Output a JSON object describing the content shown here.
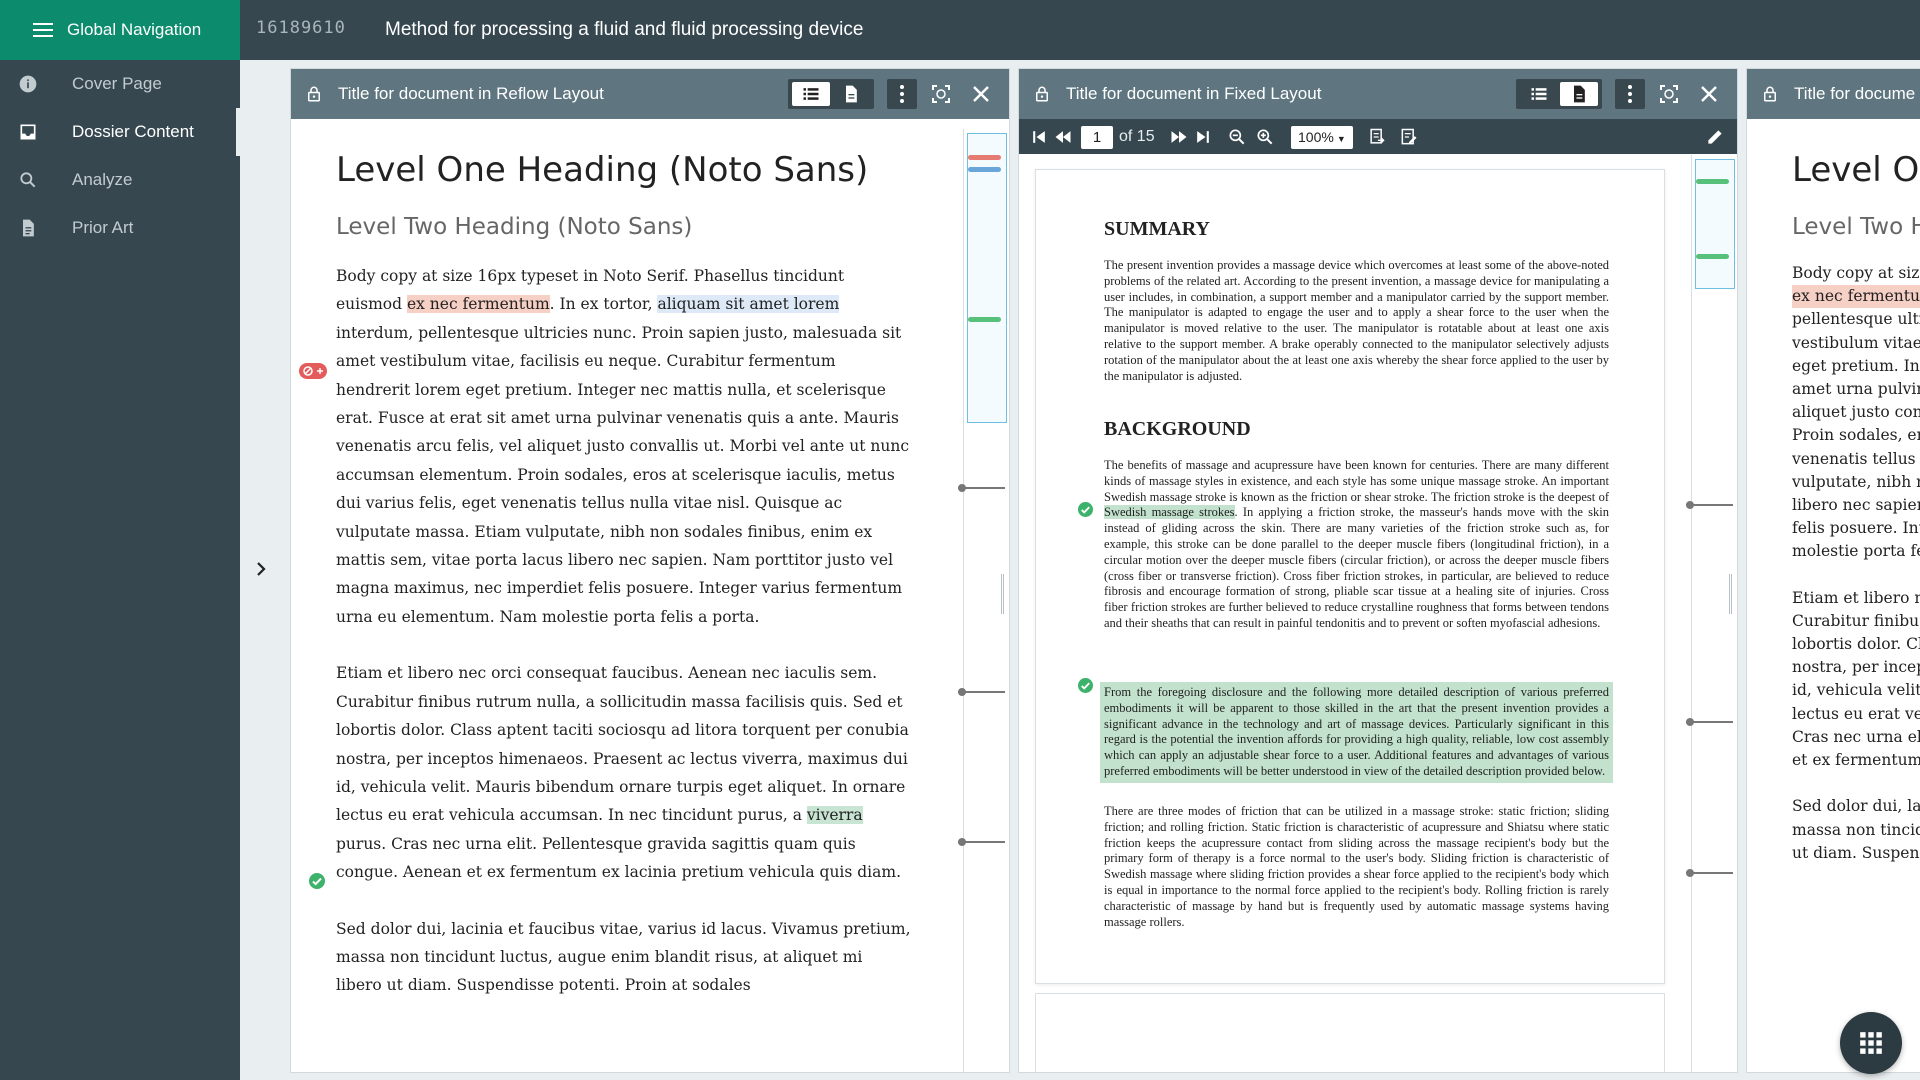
{
  "global_nav": {
    "label": "Global Navigation"
  },
  "document": {
    "id": "16189610",
    "title": "Method for processing a fluid and fluid processing device"
  },
  "sidebar": {
    "items": [
      {
        "label": "Cover Page",
        "icon": "info-icon"
      },
      {
        "label": "Dossier Content",
        "icon": "inbox-icon",
        "active": true
      },
      {
        "label": "Analyze",
        "icon": "search-icon"
      },
      {
        "label": "Prior Art",
        "icon": "document-icon"
      }
    ]
  },
  "panels": {
    "reflow": {
      "title": "Title for document in Reflow Layout",
      "heading1": "Level One Heading  (Noto Sans)",
      "heading2": "Level Two Heading (Noto Sans)",
      "p1_a": "Body copy at size 16px typeset in Noto Serif. Phasellus tincidunt euismod ",
      "p1_hl_red": "ex nec fermentum",
      "p1_b": ". In ex tortor, ",
      "p1_hl_blue": "aliquam sit amet lorem",
      "p1_c": " interdum, pellentesque ultricies nunc. Proin sapien justo, malesuada sit amet vestibulum vitae, facilisis eu neque. Curabitur fermentum hendrerit lorem eget pretium. Integer nec mattis nulla, et scelerisque erat. Fusce at erat sit amet urna pulvinar venenatis quis a ante. Mauris venenatis arcu felis, vel aliquet justo convallis ut. Morbi vel ante ut nunc accumsan elementum. Proin sodales, eros at scelerisque iaculis, metus dui varius felis, eget venenatis tellus nulla vitae nisl. Quisque ac vulputate massa. Etiam vulputate, nibh non sodales finibus, enim ex mattis sem, vitae porta lacus libero nec sapien. Nam porttitor justo vel magna maximus, nec imperdiet felis posuere. Integer varius fermentum urna eu elementum. Nam molestie porta felis a porta.",
      "p2_a": "Etiam et libero nec orci consequat faucibus. Aenean nec iaculis sem. Curabitur finibus rutrum nulla, a sollicitudin massa facilisis quis. Sed et lobortis dolor. Class aptent taciti sociosqu ad litora torquent per conubia nostra, per inceptos himenaeos. Praesent ac lectus viverra, maximus dui id, vehicula velit. Mauris bibendum ornare turpis eget aliquet. In ornare lectus eu erat vehicula accumsan. In nec tincidunt purus, a ",
      "p2_hl_green": "viverra",
      "p2_b": " purus. Cras nec urna elit. Pellentesque gravida sagittis quam quis congue. Aenean et ex fermentum ex lacinia pretium vehicula quis diam.",
      "p3": "Sed dolor dui, lacinia et faucibus vitae, varius id lacus. Vivamus pretium, massa non tincidunt luctus, augue enim blandit risus, at aliquet mi libero ut diam. Suspendisse potenti. Proin at sodales"
    },
    "fixed": {
      "title": "Title for document in Fixed Layout",
      "page_current": "1",
      "page_of": "of 15",
      "zoom": "100%",
      "summary_heading": "SUMMARY",
      "summary_text": "The present invention provides a massage device which overcomes at least some of the above-noted problems of the related art. According to the present invention, a massage device for manipulating a user includes, in combination, a support member and a manipulator carried by the support member. The manipulator is adapted to engage the user and to apply a shear force to the user when the manipulator is moved relative to the user. The manipulator is rotatable about at least one axis relative to the support member. A brake operably connected to the manipulator selectively adjusts rotation of the manipulator about the at least one axis whereby the shear force applied to the user by the manipulator is adjusted.",
      "background_heading": "BACKGROUND",
      "bg1_a": "The benefits of massage and acupressure have been known for centuries. There are many different kinds of massage styles in existence, and each style has some unique massage stroke. An important Swedish massage stroke is known as the friction or shear stroke. The friction stroke is the deepest of ",
      "bg1_hl": "Swedish massage strokes",
      "bg1_b": ". In applying a friction stroke, the masseur's hands move with the skin instead of gliding across the skin. There are many varieties of the friction stroke such as, for example, this stroke can be done parallel to the deeper muscle fibers (longitudinal friction), in a circular motion over the deeper muscle fibers (circular friction), or across the deeper muscle fibers (cross fiber or transverse friction). Cross fiber friction strokes, in particular, are believed to reduce fibrosis and encourage formation of strong, pliable scar tissue at a healing site of injuries. Cross fiber friction strokes are further believed to reduce crystalline roughness that forms between tendons and their sheaths that can result in painful tendonitis and to prevent or soften myofascial adhesions.",
      "bg2": "From the foregoing disclosure and the following more detailed description of various preferred embodiments it will be apparent to those skilled in the art that the present invention provides a significant advance in the technology and art of massage devices. Particularly significant in this regard is the potential the invention affords for providing a high quality, reliable, low cost assembly which can apply an adjustable shear force to a user. Additional features and advantages of various preferred embodiments will be better understood in view of the detailed description provided below.",
      "bg3": "There are three modes of friction that can be utilized in a massage stroke: static friction; sliding friction; and rolling friction. Static friction is characteristic of acupressure and Shiatsu where static friction keeps the acupressure contact from sliding across the massage recipient's body but the primary form of therapy is a force normal to the user's body. Sliding friction is characteristic of Swedish massage where sliding friction provides a shear force applied to the recipient's body which is equal in importance to the normal force applied to the recipient's body. Rolling friction is rarely characteristic of massage by hand but is frequently used by automatic massage systems having massage rollers."
    },
    "third": {
      "title": "Title for docume",
      "heading1": "Level On",
      "heading2": "Level Two H",
      "lines": [
        "Body copy at size",
        "ex nec fermentum",
        "pellentesque ultr",
        "vestibulum vitae",
        "eget pretium. Int",
        "amet urna pulvin",
        "aliquet justo conv",
        "Proin sodales, er",
        "venenatis tellus n",
        "vulputate, nibh n",
        "libero nec sapien",
        "felis posuere. Int",
        "molestie porta fe",
        "",
        "Etiam et libero n",
        "Curabitur finibus",
        "lobortis dolor. Cl",
        "nostra, per incep",
        "id, vehicula velit.",
        "lectus eu erat veh",
        "Cras nec urna eli",
        "et ex fermentum",
        "",
        "Sed dolor dui, lac",
        "massa non tincid",
        "ut diam. Suspend"
      ]
    }
  },
  "colors": {
    "nav_green": "#0d8b6d",
    "header_slate": "#36474f",
    "panel_header": "#5f7680",
    "highlight_red": "#f6cfc5",
    "highlight_green": "#c8e4d3",
    "highlight_blue": "#dde9f7",
    "annotation_green": "#3cb26b",
    "annotation_red": "#e45b5b"
  }
}
